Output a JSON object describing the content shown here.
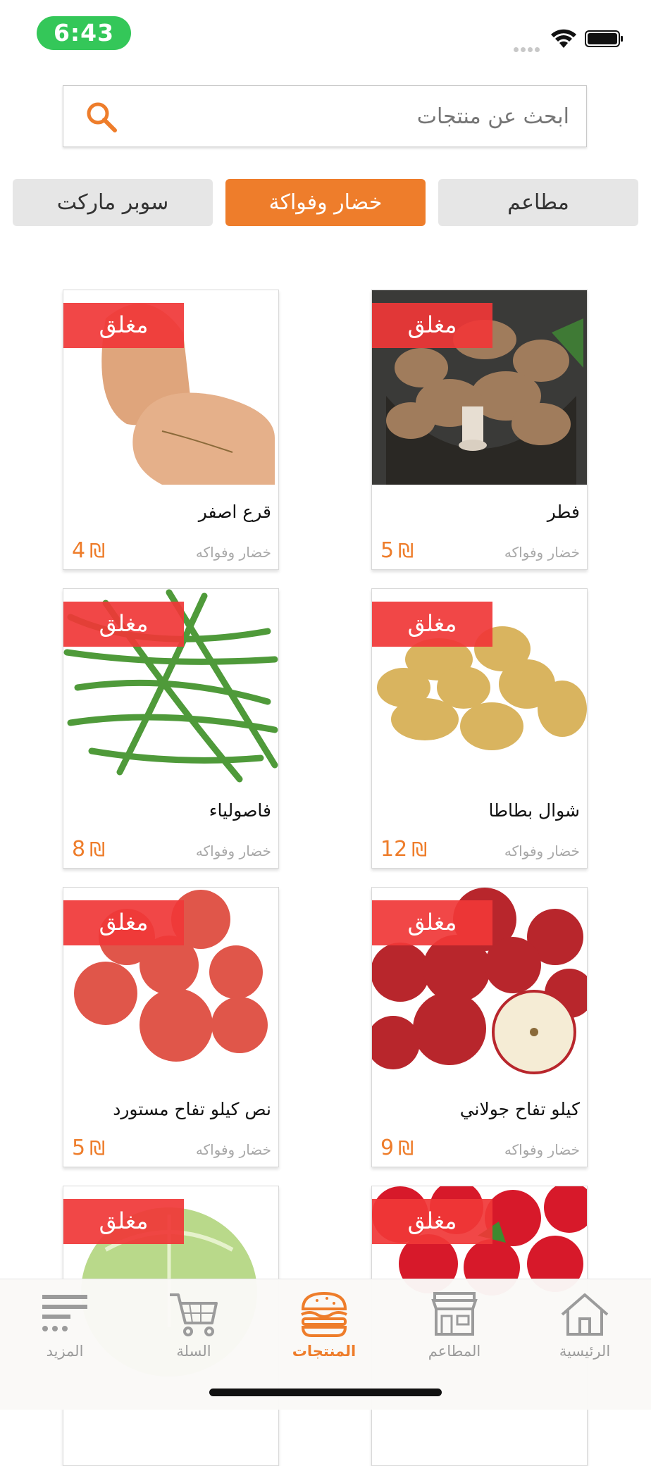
{
  "status_bar": {
    "time": "6:43"
  },
  "search": {
    "placeholder": "ابحث عن منتجات"
  },
  "categories": [
    {
      "label": "مطاعم",
      "active": false
    },
    {
      "label": "خضار وفواكة",
      "active": true
    },
    {
      "label": "سوبر ماركت",
      "active": false
    }
  ],
  "products": [
    {
      "name": "فطر",
      "category": "خضار وفواكه",
      "price": "5",
      "currency": "₪",
      "status": "مغلق"
    },
    {
      "name": "قرع اصفر",
      "category": "خضار وفواكه",
      "price": "4",
      "currency": "₪",
      "status": "مغلق"
    },
    {
      "name": "شوال بطاطا",
      "category": "خضار وفواكه",
      "price": "12",
      "currency": "₪",
      "status": "مغلق"
    },
    {
      "name": "فاصولياء",
      "category": "خضار وفواكه",
      "price": "8",
      "currency": "₪",
      "status": "مغلق"
    },
    {
      "name": "كيلو تفاح جولاني",
      "category": "خضار وفواكه",
      "price": "9",
      "currency": "₪",
      "status": "مغلق"
    },
    {
      "name": "نص كيلو تفاح مستورد",
      "category": "خضار وفواكه",
      "price": "5",
      "currency": "₪",
      "status": "مغلق"
    },
    {
      "status": "مغلق"
    },
    {
      "status": "مغلق"
    }
  ],
  "tabbar": [
    {
      "label": "الرئيسية",
      "icon": "home-icon",
      "active": false
    },
    {
      "label": "المطاعم",
      "icon": "store-icon",
      "active": false
    },
    {
      "label": "المنتجات",
      "icon": "burger-icon",
      "active": true
    },
    {
      "label": "السلة",
      "icon": "cart-icon",
      "active": false
    },
    {
      "label": "المزيد",
      "icon": "menu-icon",
      "active": false
    }
  ],
  "colors": {
    "accent": "#ee7d2b",
    "closed_badge": "#f03737",
    "time_pill": "#34c759"
  }
}
